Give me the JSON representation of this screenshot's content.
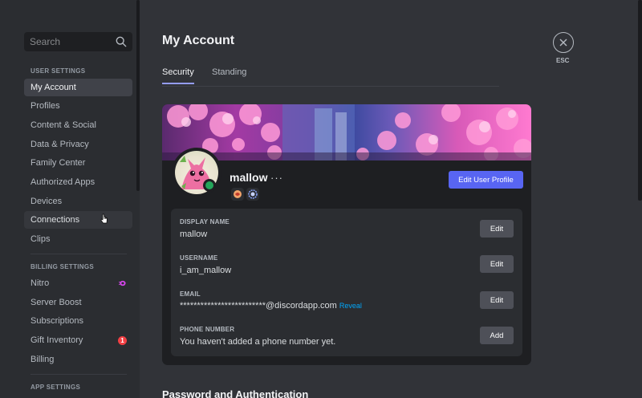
{
  "sidebar": {
    "search_placeholder": "Search",
    "sections": {
      "user_settings": "USER SETTINGS",
      "billing_settings": "BILLING SETTINGS",
      "app_settings": "APP SETTINGS"
    },
    "user_items": [
      "My Account",
      "Profiles",
      "Content & Social",
      "Data & Privacy",
      "Family Center",
      "Authorized Apps",
      "Devices",
      "Connections",
      "Clips"
    ],
    "billing_items": [
      "Nitro",
      "Server Boost",
      "Subscriptions",
      "Gift Inventory",
      "Billing"
    ],
    "gift_inventory_badge": "1",
    "active_item": "My Account"
  },
  "main": {
    "title": "My Account",
    "tabs": [
      "Security",
      "Standing"
    ],
    "esc_label": "ESC",
    "profile": {
      "username": "mallow",
      "more": "···",
      "edit_profile_label": "Edit User Profile"
    },
    "fields": [
      {
        "label": "DISPLAY NAME",
        "value": "mallow",
        "button": "Edit"
      },
      {
        "label": "USERNAME",
        "value": "i_am_mallow",
        "button": "Edit"
      },
      {
        "label": "EMAIL",
        "value": "*************************@discordapp.com",
        "extra": "Reveal",
        "button": "Edit"
      },
      {
        "label": "PHONE NUMBER",
        "value": "You haven't added a phone number yet.",
        "button": "Add"
      }
    ],
    "next_section": "Password and Authentication"
  },
  "colors": {
    "accent": "#5865f2",
    "online": "#23a55a",
    "danger": "#f23f43",
    "link": "#00a8fc"
  }
}
